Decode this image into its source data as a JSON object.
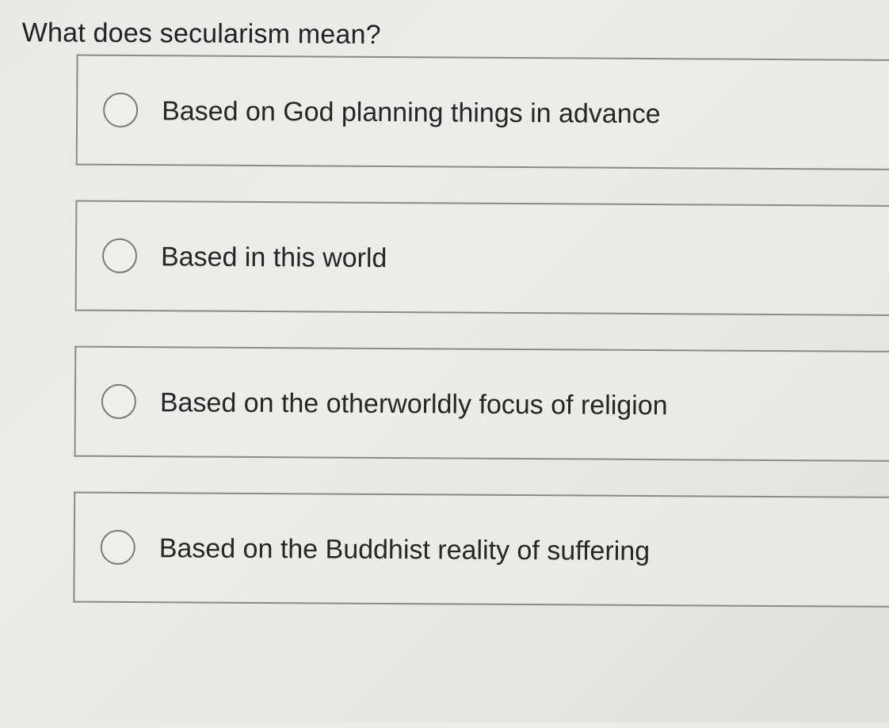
{
  "question": {
    "text": "What does secularism mean?"
  },
  "options": [
    {
      "label": "Based on God planning things in advance",
      "selected": false
    },
    {
      "label": "Based in this world",
      "selected": false
    },
    {
      "label": "Based on the otherworldly focus of religion",
      "selected": false
    },
    {
      "label": "Based on the Buddhist reality of suffering",
      "selected": false
    }
  ]
}
